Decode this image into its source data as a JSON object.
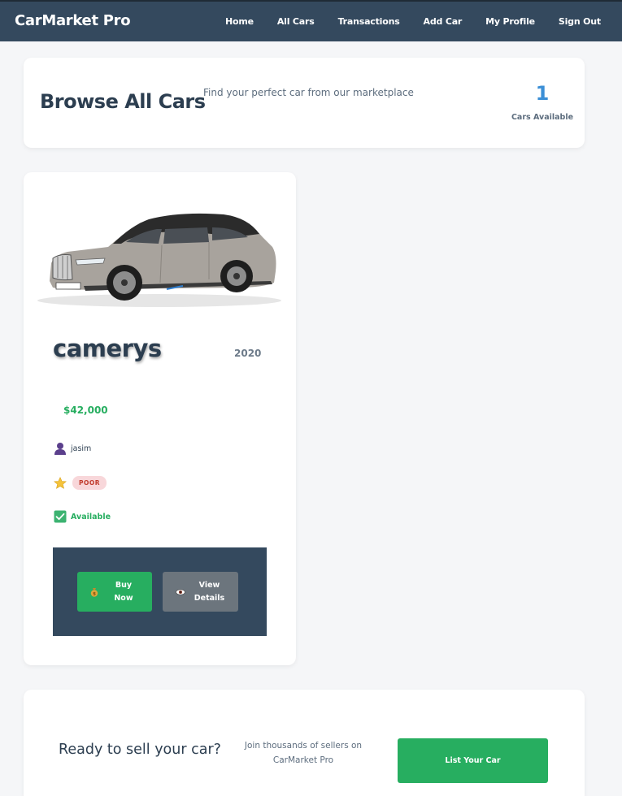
{
  "navbar": {
    "brand": "CarMarket Pro",
    "links": [
      "Home",
      "All Cars",
      "Transactions",
      "Add Car",
      "My Profile",
      "Sign Out"
    ]
  },
  "header": {
    "title": "Browse All Cars",
    "subtitle": "Find your perfect car from our marketplace",
    "stat_count": "1",
    "stat_label": "Cars Available"
  },
  "cars": [
    {
      "name": "camerys",
      "year": "2020",
      "price": "$42,000",
      "seller": "jasim",
      "seller_icon": "user-icon",
      "condition": "POOR",
      "condition_icon": "star-icon",
      "status": "Available",
      "status_icon": "checkmark-icon",
      "image": "car-photo",
      "buy_label": "Buy Now",
      "buy_icon": "money-bag-icon",
      "view_label": "View Details",
      "view_icon": "eye-icon"
    }
  ],
  "cta": {
    "title": "Ready to sell your car?",
    "text": "Join thousands of sellers on CarMarket Pro",
    "button_label": "List Your Car"
  },
  "colors": {
    "navbar": "#34495e",
    "accent_blue": "#3b8fd6",
    "success_green": "#27ae60",
    "secondary_gray": "#6c757d",
    "badge_poor_bg": "#f8d7da",
    "badge_poor_text": "#c0392b",
    "background": "#f5f6f8"
  }
}
